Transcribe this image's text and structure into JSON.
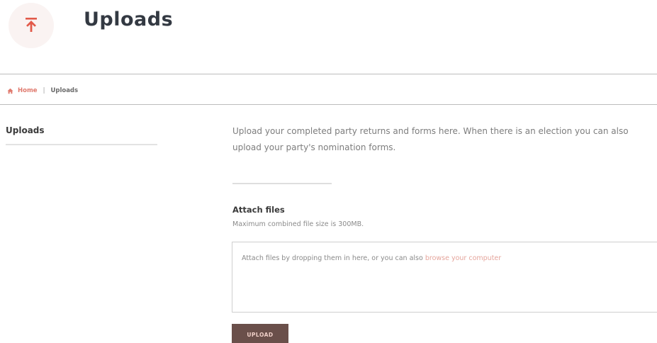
{
  "header": {
    "title": "Uploads",
    "icon": "upload-arrow-icon",
    "accent_color": "#e25a4a"
  },
  "breadcrumb": {
    "home_label": "Home",
    "separator": "|",
    "current_label": "Uploads"
  },
  "sidebar": {
    "title": "Uploads"
  },
  "main": {
    "intro_text": "Upload your completed party returns and forms here. When there is an election you can also upload your party's nomination forms.",
    "attach": {
      "title": "Attach files",
      "hint": "Maximum combined file size is 300MB.",
      "dropzone_text": "Attach files by dropping them in here, or you can also",
      "browse_link": "browse your computer"
    },
    "upload_button": "UPLOAD"
  },
  "colors": {
    "link": "#e07a6e",
    "button_bg": "#6a4f4a"
  }
}
